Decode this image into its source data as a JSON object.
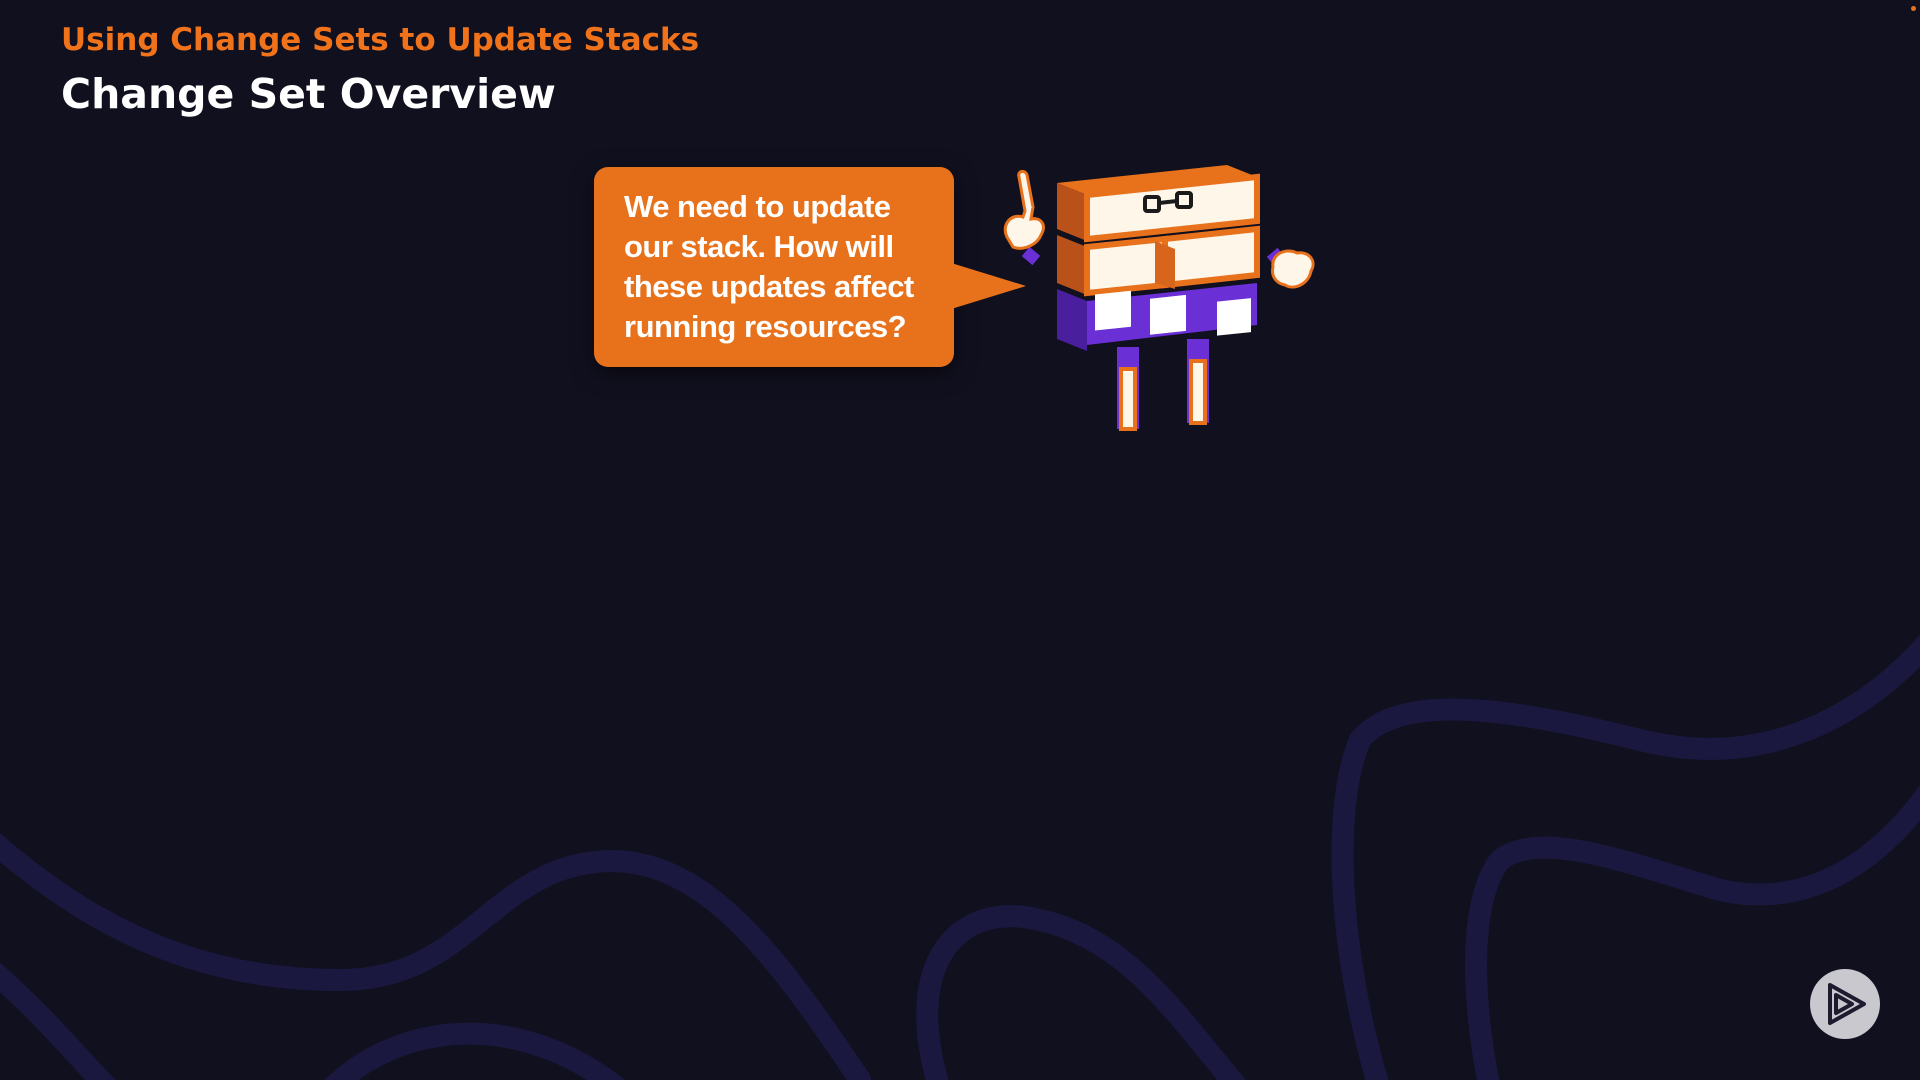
{
  "slide": {
    "subtitle": "Using Change Sets to Update Stacks",
    "title": "Change Set Overview"
  },
  "speech_bubble": {
    "lines": [
      "We need to update",
      "our stack. How will",
      "these updates affect",
      "running resources?"
    ]
  },
  "colors": {
    "background": "#11101f",
    "accent_orange": "#e8711b",
    "accent_purple": "#6b2fd6",
    "title_white": "#ffffff"
  },
  "icons": {
    "play_logo": "pluralsight-play-icon",
    "mascot": "block-robot-mascot"
  }
}
